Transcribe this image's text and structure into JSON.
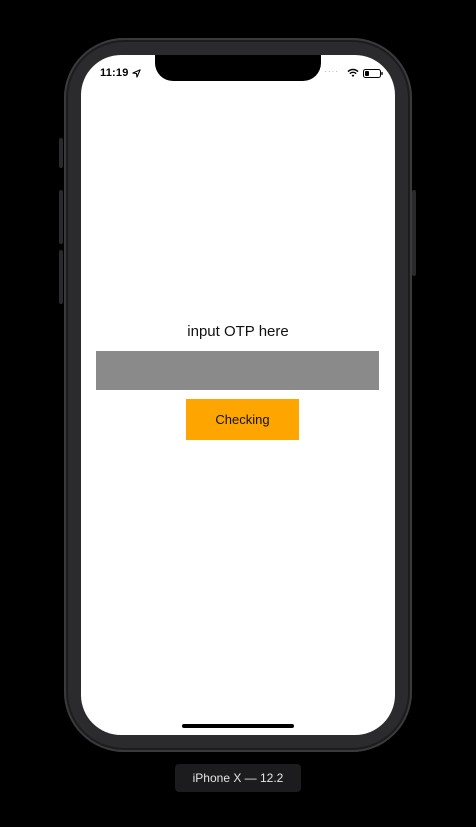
{
  "status_bar": {
    "time": "11:19",
    "icons": [
      "location-arrow-icon",
      "cellular-dots-icon",
      "wifi-icon",
      "battery-icon"
    ]
  },
  "main": {
    "label": "input OTP here",
    "otp_input": {
      "value": "",
      "placeholder": ""
    },
    "check_button_label": "Checking"
  },
  "device_caption": "iPhone X — 12.2",
  "colors": {
    "button_bg": "#ffa500",
    "input_bg": "#8a8a8a",
    "screen_bg": "#ffffff",
    "backdrop": "#000000"
  }
}
